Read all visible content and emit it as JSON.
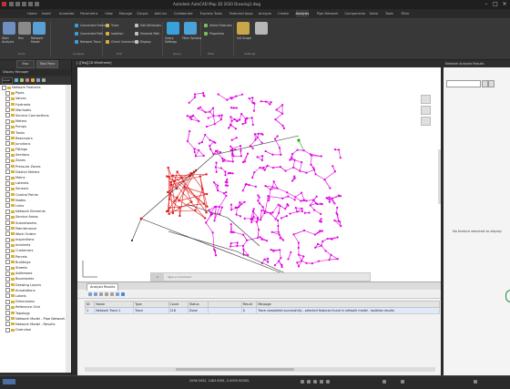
{
  "app": {
    "title": "Autodesk AutoCAD Map 3D 2020   Drawing1.dwg"
  },
  "ribbon_tabs": [
    {
      "label": "Home",
      "active": false
    },
    {
      "label": "Insert",
      "active": false
    },
    {
      "label": "Annotate",
      "active": false
    },
    {
      "label": "Parametric",
      "active": false
    },
    {
      "label": "View",
      "active": false
    },
    {
      "label": "Manage",
      "active": false
    },
    {
      "label": "Output",
      "active": false
    },
    {
      "label": "Add-ins",
      "active": false
    },
    {
      "label": "Collaborate",
      "active": false
    },
    {
      "label": "Express Tools",
      "active": false
    },
    {
      "label": "Featured Apps",
      "active": false
    },
    {
      "label": "Analyze",
      "active": false
    },
    {
      "label": "Create",
      "active": false
    },
    {
      "label": "Analysis",
      "active": true
    },
    {
      "label": "Pipe Network",
      "active": false
    },
    {
      "label": "Components",
      "active": false
    },
    {
      "label": "Valve",
      "active": false
    },
    {
      "label": "Tools",
      "active": false
    },
    {
      "label": "Filter",
      "active": false
    }
  ],
  "ribbon_groups": [
    {
      "label": "Tools"
    },
    {
      "label": "Analysis"
    },
    {
      "label": "Edit"
    },
    {
      "label": "Query"
    },
    {
      "label": "Filter"
    },
    {
      "label": "Settings"
    }
  ],
  "ribbon_buttons": [
    {
      "label": "Start\nAnalysis"
    },
    {
      "label": "Run"
    },
    {
      "label": "Network\nModel"
    },
    {
      "label": "Connected Feature"
    },
    {
      "label": "Connected Path"
    },
    {
      "label": "Network Trace"
    },
    {
      "label": "Trace"
    },
    {
      "label": "Isolation"
    },
    {
      "label": "Check Connectivity"
    },
    {
      "label": "Edit Attributes"
    },
    {
      "label": "Shortest Path"
    },
    {
      "label": "Display"
    },
    {
      "label": "Query\nSettings"
    },
    {
      "label": "Filter Options"
    },
    {
      "label": "Select Features"
    },
    {
      "label": "Properties"
    },
    {
      "label": "Set Scope"
    }
  ],
  "left_panel": {
    "tabs": [
      "Map",
      "Task Pane"
    ],
    "header": "Display Manager",
    "filter_value": "Layer",
    "tree_items": [
      "Network Features",
      "Pipes",
      "Valves",
      "Hydrants",
      "Manholes",
      "Service Connections",
      "Meters",
      "Pumps",
      "Tanks",
      "Reservoirs",
      "Junctions",
      "Fittings",
      "Sections",
      "Zones",
      "Pressure Zones",
      "District Meters",
      "Mains",
      "Laterals",
      "Sensors",
      "Control Points",
      "Nodes",
      "Links",
      "Network Elements",
      "Service Areas",
      "Subnetworks",
      "Maintenance",
      "Work Orders",
      "Inspections",
      "Incidents",
      "Customers",
      "Parcels",
      "Buildings",
      "Streets",
      "Addresses",
      "Boundaries",
      "Drawing Layers",
      "Annotations",
      "Labels",
      "Dimensions",
      "Reference Grid",
      "Topology",
      "Network Model - Pipe Network",
      "Network Model - Results",
      "Overview"
    ]
  },
  "drawing": {
    "tab_label": "[-][Top][2D Wireframe]",
    "command_prompt": "Type a command",
    "colors": {
      "network": "#e000e0",
      "highlight": "#e01818",
      "start_node": "#16b016",
      "path": "#333333"
    }
  },
  "grid": {
    "tab_label": "Analysis Results",
    "columns": [
      "ID",
      "Name",
      "Type",
      "Count",
      "Status",
      "",
      "Result",
      "Message"
    ],
    "rows": [
      [
        "1",
        "Network Trace-1",
        "Trace",
        "218",
        "Done",
        "",
        "0",
        "Trace completed successfully - selected features found in network model - isolation results"
      ]
    ]
  },
  "right_panel": {
    "header": "Network Analysis Results",
    "message": "No feature selected to display"
  },
  "statusbar": {
    "model_label": "MODEL",
    "coords_text": "2096.3452, 1483.9061, 0.0000   MODEL"
  }
}
